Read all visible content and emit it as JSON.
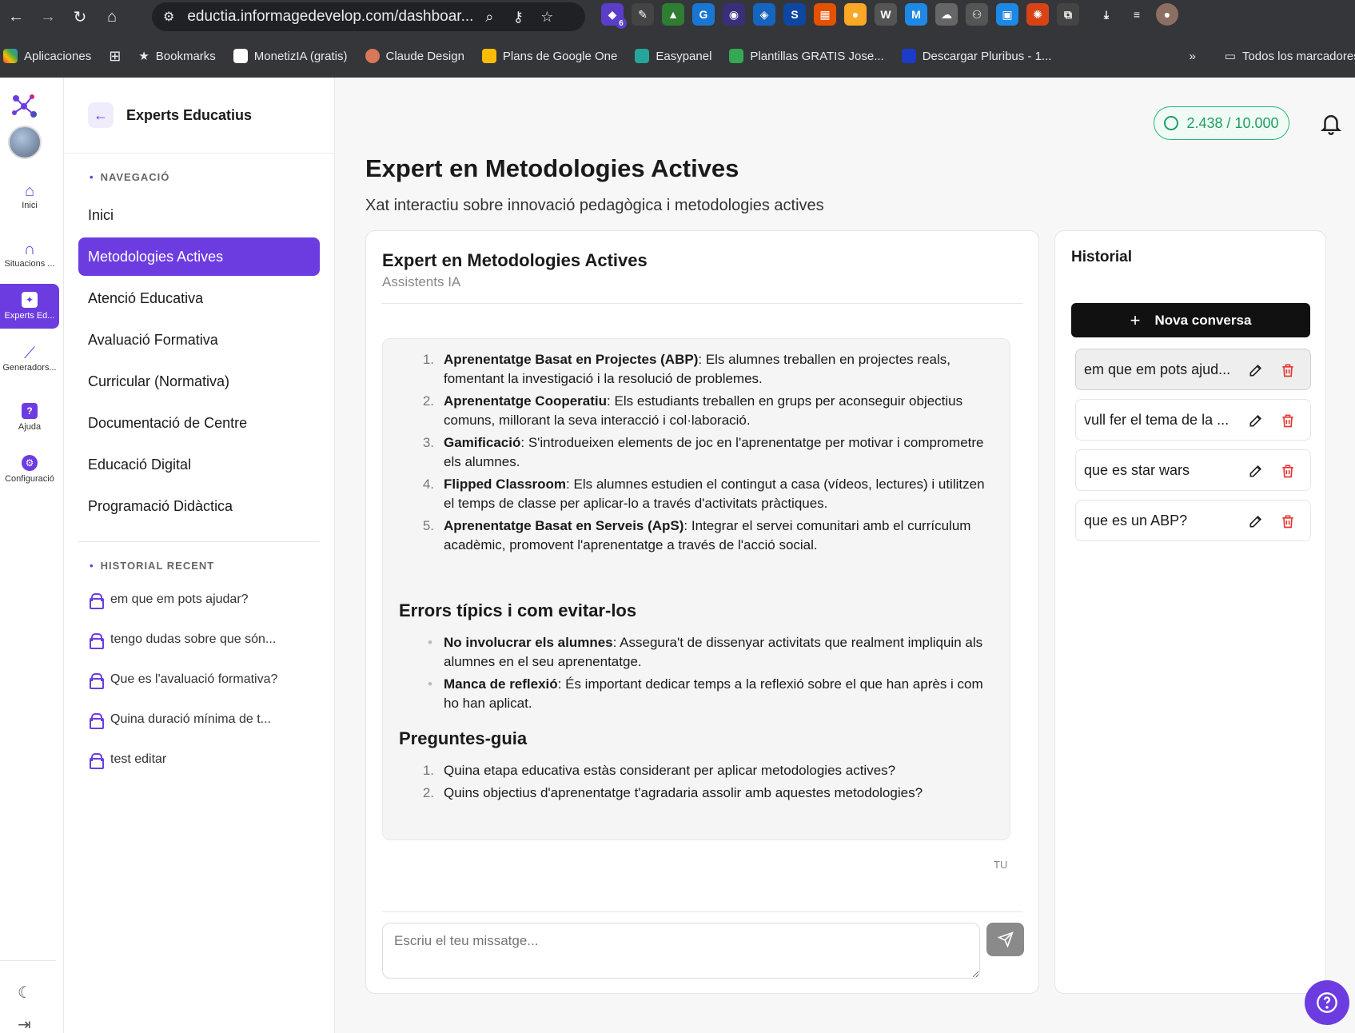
{
  "browser": {
    "url": "eductia.informagedevelop.com/dashboar...",
    "extension_badge": "6",
    "bookmarks": [
      "Aplicaciones",
      "Bookmarks",
      "MonetizIA (gratis)",
      "Claude Design",
      "Plans de Google One",
      "Easypanel",
      "Plantillas GRATIS Jose...",
      "Descargar Pluribus - 1...",
      "Todos los marcadores"
    ]
  },
  "rail": {
    "items": [
      {
        "label": "Inici",
        "icon": "home-icon"
      },
      {
        "label": "Situacions ...",
        "icon": "situations-icon"
      },
      {
        "label": "Experts Ed...",
        "icon": "experts-icon"
      },
      {
        "label": "Generadors...",
        "icon": "wand-icon"
      },
      {
        "label": "Ajuda",
        "icon": "help-icon"
      },
      {
        "label": "Configuració",
        "icon": "settings-icon"
      }
    ]
  },
  "sidebar": {
    "title": "Experts Educatius",
    "nav_section": "NAVEGACIÓ",
    "nav": [
      "Inici",
      "Metodologies Actives",
      "Atenció Educativa",
      "Avaluació Formativa",
      "Curricular (Normativa)",
      "Documentació de Centre",
      "Educació Digital",
      "Programació Didàctica"
    ],
    "history_section": "HISTORIAL RECENT",
    "history": [
      "em que em pots ajudar?",
      "tengo dudas sobre que són...",
      "Que es l'avaluació formativa?",
      "Quina duració mínima de t...",
      "test editar"
    ]
  },
  "header": {
    "credits": "2.438 / 10.000",
    "title": "Expert en Metodologies Actives",
    "subtitle": "Xat interactiu sobre innovació pedagògica i metodologies actives"
  },
  "chat": {
    "title": "Expert en Metodologies Actives",
    "subtitle": "Assistents IA",
    "methods": [
      {
        "n": "1.",
        "term": "Aprenentatge Basat en Projectes (ABP)",
        "text": ": Els alumnes treballen en projectes reals, fomentant la investigació i la resolució de problemes."
      },
      {
        "n": "2.",
        "term": "Aprenentatge Cooperatiu",
        "text": ": Els estudiants treballen en grups per aconseguir objectius comuns, millorant la seva interacció i col·laboració."
      },
      {
        "n": "3.",
        "term": "Gamificació",
        "text": ": S'introdueixen elements de joc en l'aprenentatge per motivar i comprometre els alumnes."
      },
      {
        "n": "4.",
        "term": "Flipped Classroom",
        "text": ": Els alumnes estudien el contingut a casa (vídeos, lectures) i utilitzen el temps de classe per aplicar-lo a través d'activitats pràctiques."
      },
      {
        "n": "5.",
        "term": "Aprenentatge Basat en Serveis (ApS)",
        "text": ": Integrar el servei comunitari amb el currículum acadèmic, promovent l'aprenentatge a través de l'acció social."
      }
    ],
    "errors_heading": "Errors típics i com evitar-los",
    "errors": [
      {
        "term": "No involucrar els alumnes",
        "text": ": Assegura't de dissenyar activitats que realment impliquin als alumnes en el seu aprenentatge."
      },
      {
        "term": "Manca de reflexió",
        "text": ": És important dedicar temps a la reflexió sobre el que han après i com ho han aplicat."
      }
    ],
    "questions_heading": "Preguntes-guia",
    "questions": [
      {
        "n": "1.",
        "text": "Quina etapa educativa estàs considerant per aplicar metodologies actives?"
      },
      {
        "n": "2.",
        "text": "Quins objectius d'aprenentatge t'agradaria assolir amb aquestes metodologies?"
      }
    ],
    "sender_tag": "TU",
    "input_placeholder": "Escriu el teu missatge..."
  },
  "history": {
    "title": "Historial",
    "new_button": "Nova conversa",
    "conversations": [
      "em que em pots ajud...",
      "vull fer el tema de la ...",
      "que es star wars",
      "que es un ABP?"
    ]
  },
  "colors": {
    "accent": "#6c3ce1",
    "credits": "#1f9e62",
    "danger": "#e53935"
  }
}
